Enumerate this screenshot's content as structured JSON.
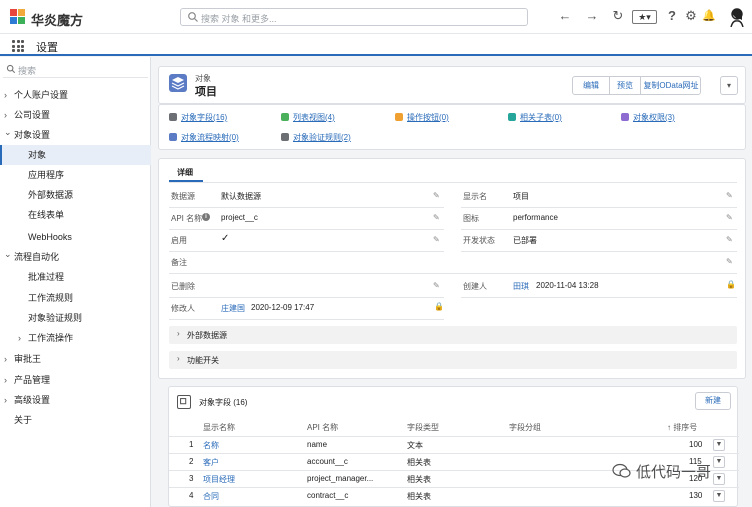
{
  "topbar": {
    "brand": "华炎魔方",
    "search_placeholder": "搜索 对象 和更多...",
    "favorites": "★▾",
    "help": "?",
    "settings": "⚙",
    "notifications": "🔔"
  },
  "subbar": {
    "title": "设置"
  },
  "sidebar": {
    "search_placeholder": "搜索",
    "items": [
      {
        "label": "个人账户设置",
        "chev": "›"
      },
      {
        "label": "公司设置",
        "chev": "›"
      },
      {
        "label": "对象设置",
        "chev": "⌄"
      },
      {
        "label": "对象"
      },
      {
        "label": "应用程序"
      },
      {
        "label": "外部数据源"
      },
      {
        "label": "在线表单"
      },
      {
        "label": "WebHooks"
      },
      {
        "label": "流程自动化",
        "chev": "⌄"
      },
      {
        "label": "批准过程"
      },
      {
        "label": "工作流规则"
      },
      {
        "label": "对象验证规则"
      },
      {
        "label": "工作流操作",
        "chev": "›"
      },
      {
        "label": "审批王",
        "chev": "›"
      },
      {
        "label": "产品管理",
        "chev": "›"
      },
      {
        "label": "高级设置",
        "chev": "›"
      },
      {
        "label": "关于"
      }
    ]
  },
  "object_header": {
    "type_label": "对象",
    "name": "项目",
    "buttons": [
      "编辑",
      "预览",
      "复制OData网址",
      "▾"
    ]
  },
  "quick_links": [
    {
      "label": "对象字段(16)",
      "color": "#6b6f74"
    },
    {
      "label": "列表视图(4)",
      "color": "#4bb05c"
    },
    {
      "label": "操作按钮(0)",
      "color": "#f0a030"
    },
    {
      "label": "相关子表(0)",
      "color": "#26a69a"
    },
    {
      "label": "对象权限(3)",
      "color": "#8e6bd1"
    },
    {
      "label": "对象流程映射(0)",
      "color": "#5b7bc4"
    },
    {
      "label": "对象验证规则(2)",
      "color": "#6b6f74"
    }
  ],
  "detail": {
    "tab": "详细",
    "fields": {
      "datasource_label": "数据源",
      "datasource_value": "默认数据源",
      "display_label": "显示名",
      "display_value": "项目",
      "api_label": "API 名称",
      "api_value": "project__c",
      "icon_label": "图标",
      "icon_value": "performance",
      "enabled_label": "启用",
      "enabled_value": "✓",
      "dev_label": "开发状态",
      "dev_value": "已部署",
      "remark_label": "备注",
      "deleted_label": "已删除",
      "creator_label": "创建人",
      "creator_value": "田琪",
      "created_time": "2020-11-04 13:28",
      "modifier_label": "修改人",
      "modifier_value": "庄建国",
      "modified_time": "2020-12-09 17:47"
    },
    "sections": [
      "外部数据源",
      "功能开关"
    ]
  },
  "fields_table": {
    "title": "对象字段 (16)",
    "new_button": "新建",
    "headers": [
      "显示名称",
      "API 名称",
      "字段类型",
      "字段分组",
      "↑ 排序号"
    ],
    "rows": [
      {
        "num": "1",
        "name": "名称",
        "api": "name",
        "type": "文本",
        "group": "",
        "order": "100"
      },
      {
        "num": "2",
        "name": "客户",
        "api": "account__c",
        "type": "相关表",
        "group": "",
        "order": "115"
      },
      {
        "num": "3",
        "name": "项目经理",
        "api": "project_manager...",
        "type": "相关表",
        "group": "",
        "order": "120"
      },
      {
        "num": "4",
        "name": "合同",
        "api": "contract__c",
        "type": "相关表",
        "group": "",
        "order": "130"
      }
    ]
  },
  "watermark": "低代码一哥"
}
